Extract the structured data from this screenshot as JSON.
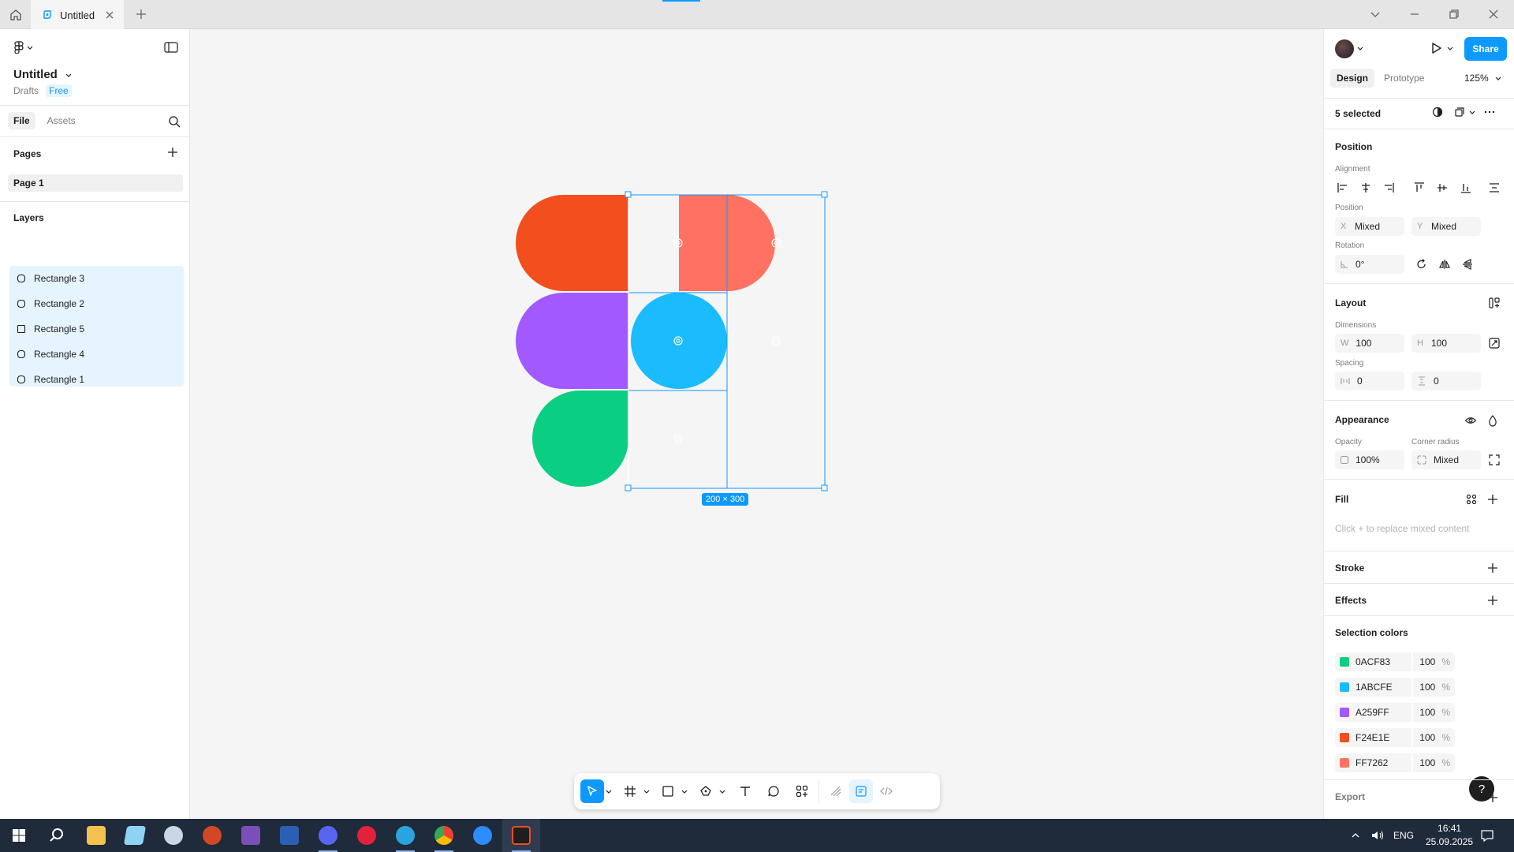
{
  "tabbar": {
    "tab_title": "Untitled"
  },
  "left": {
    "file_title": "Untitled",
    "drafts": "Drafts",
    "plan": "Free",
    "tabs": [
      "File",
      "Assets"
    ],
    "pages_heading": "Pages",
    "pages": [
      "Page 1"
    ],
    "layers_heading": "Layers",
    "layers": [
      {
        "name": "Rectangle 3",
        "shape": "rounded"
      },
      {
        "name": "Rectangle 2",
        "shape": "rounded"
      },
      {
        "name": "Rectangle 5",
        "shape": "square"
      },
      {
        "name": "Rectangle 4",
        "shape": "rounded"
      },
      {
        "name": "Rectangle 1",
        "shape": "rounded"
      }
    ]
  },
  "canvas": {
    "selection_size": "200 × 300",
    "shapes": [
      {
        "name": "Rectangle 1",
        "color": "#F24E1E"
      },
      {
        "name": "Rectangle 2",
        "color": "#FF7262"
      },
      {
        "name": "Rectangle 3",
        "color": "#A259FF"
      },
      {
        "name": "Rectangle 4",
        "color": "#1ABCFE"
      },
      {
        "name": "Rectangle 5",
        "color": "#0ACF83"
      }
    ]
  },
  "toolbar": {
    "tools": [
      "move-icon",
      "frame-icon",
      "rectangle-icon",
      "pen-icon",
      "text-icon",
      "comment-icon",
      "components-icon",
      "draw-icon",
      "dev-mode-icon",
      "code-icon"
    ]
  },
  "right": {
    "share_label": "Share",
    "tabs": [
      "Design",
      "Prototype"
    ],
    "zoom": "125%",
    "selected_label": "5 selected",
    "position_heading": "Position",
    "alignment_label": "Alignment",
    "position_label": "Position",
    "x_prefix": "X",
    "x_value": "Mixed",
    "y_prefix": "Y",
    "y_value": "Mixed",
    "rotation_label": "Rotation",
    "rotation_value": "0°",
    "layout_heading": "Layout",
    "dimensions_label": "Dimensions",
    "w_prefix": "W",
    "w_value": "100",
    "h_prefix": "H",
    "h_value": "100",
    "spacing_label": "Spacing",
    "spacing_h": "0",
    "spacing_v": "0",
    "appearance_heading": "Appearance",
    "opacity_label": "Opacity",
    "opacity_value": "100%",
    "corner_label": "Corner radius",
    "corner_value": "Mixed",
    "fill_heading": "Fill",
    "fill_hint": "Click + to replace mixed content",
    "stroke_heading": "Stroke",
    "effects_heading": "Effects",
    "selection_colors_heading": "Selection colors",
    "selection_colors": [
      {
        "hex": "0ACF83",
        "color": "#0ACF83",
        "opacity": "100"
      },
      {
        "hex": "1ABCFE",
        "color": "#1ABCFE",
        "opacity": "100"
      },
      {
        "hex": "A259FF",
        "color": "#A259FF",
        "opacity": "100"
      },
      {
        "hex": "F24E1E",
        "color": "#F24E1E",
        "opacity": "100"
      },
      {
        "hex": "FF7262",
        "color": "#FF7262",
        "opacity": "100"
      }
    ],
    "percent_sign": "%",
    "export_heading": "Export",
    "help_label": "?"
  },
  "taskbar": {
    "language": "ENG",
    "time": "16:41",
    "date": "25.09.2025"
  }
}
